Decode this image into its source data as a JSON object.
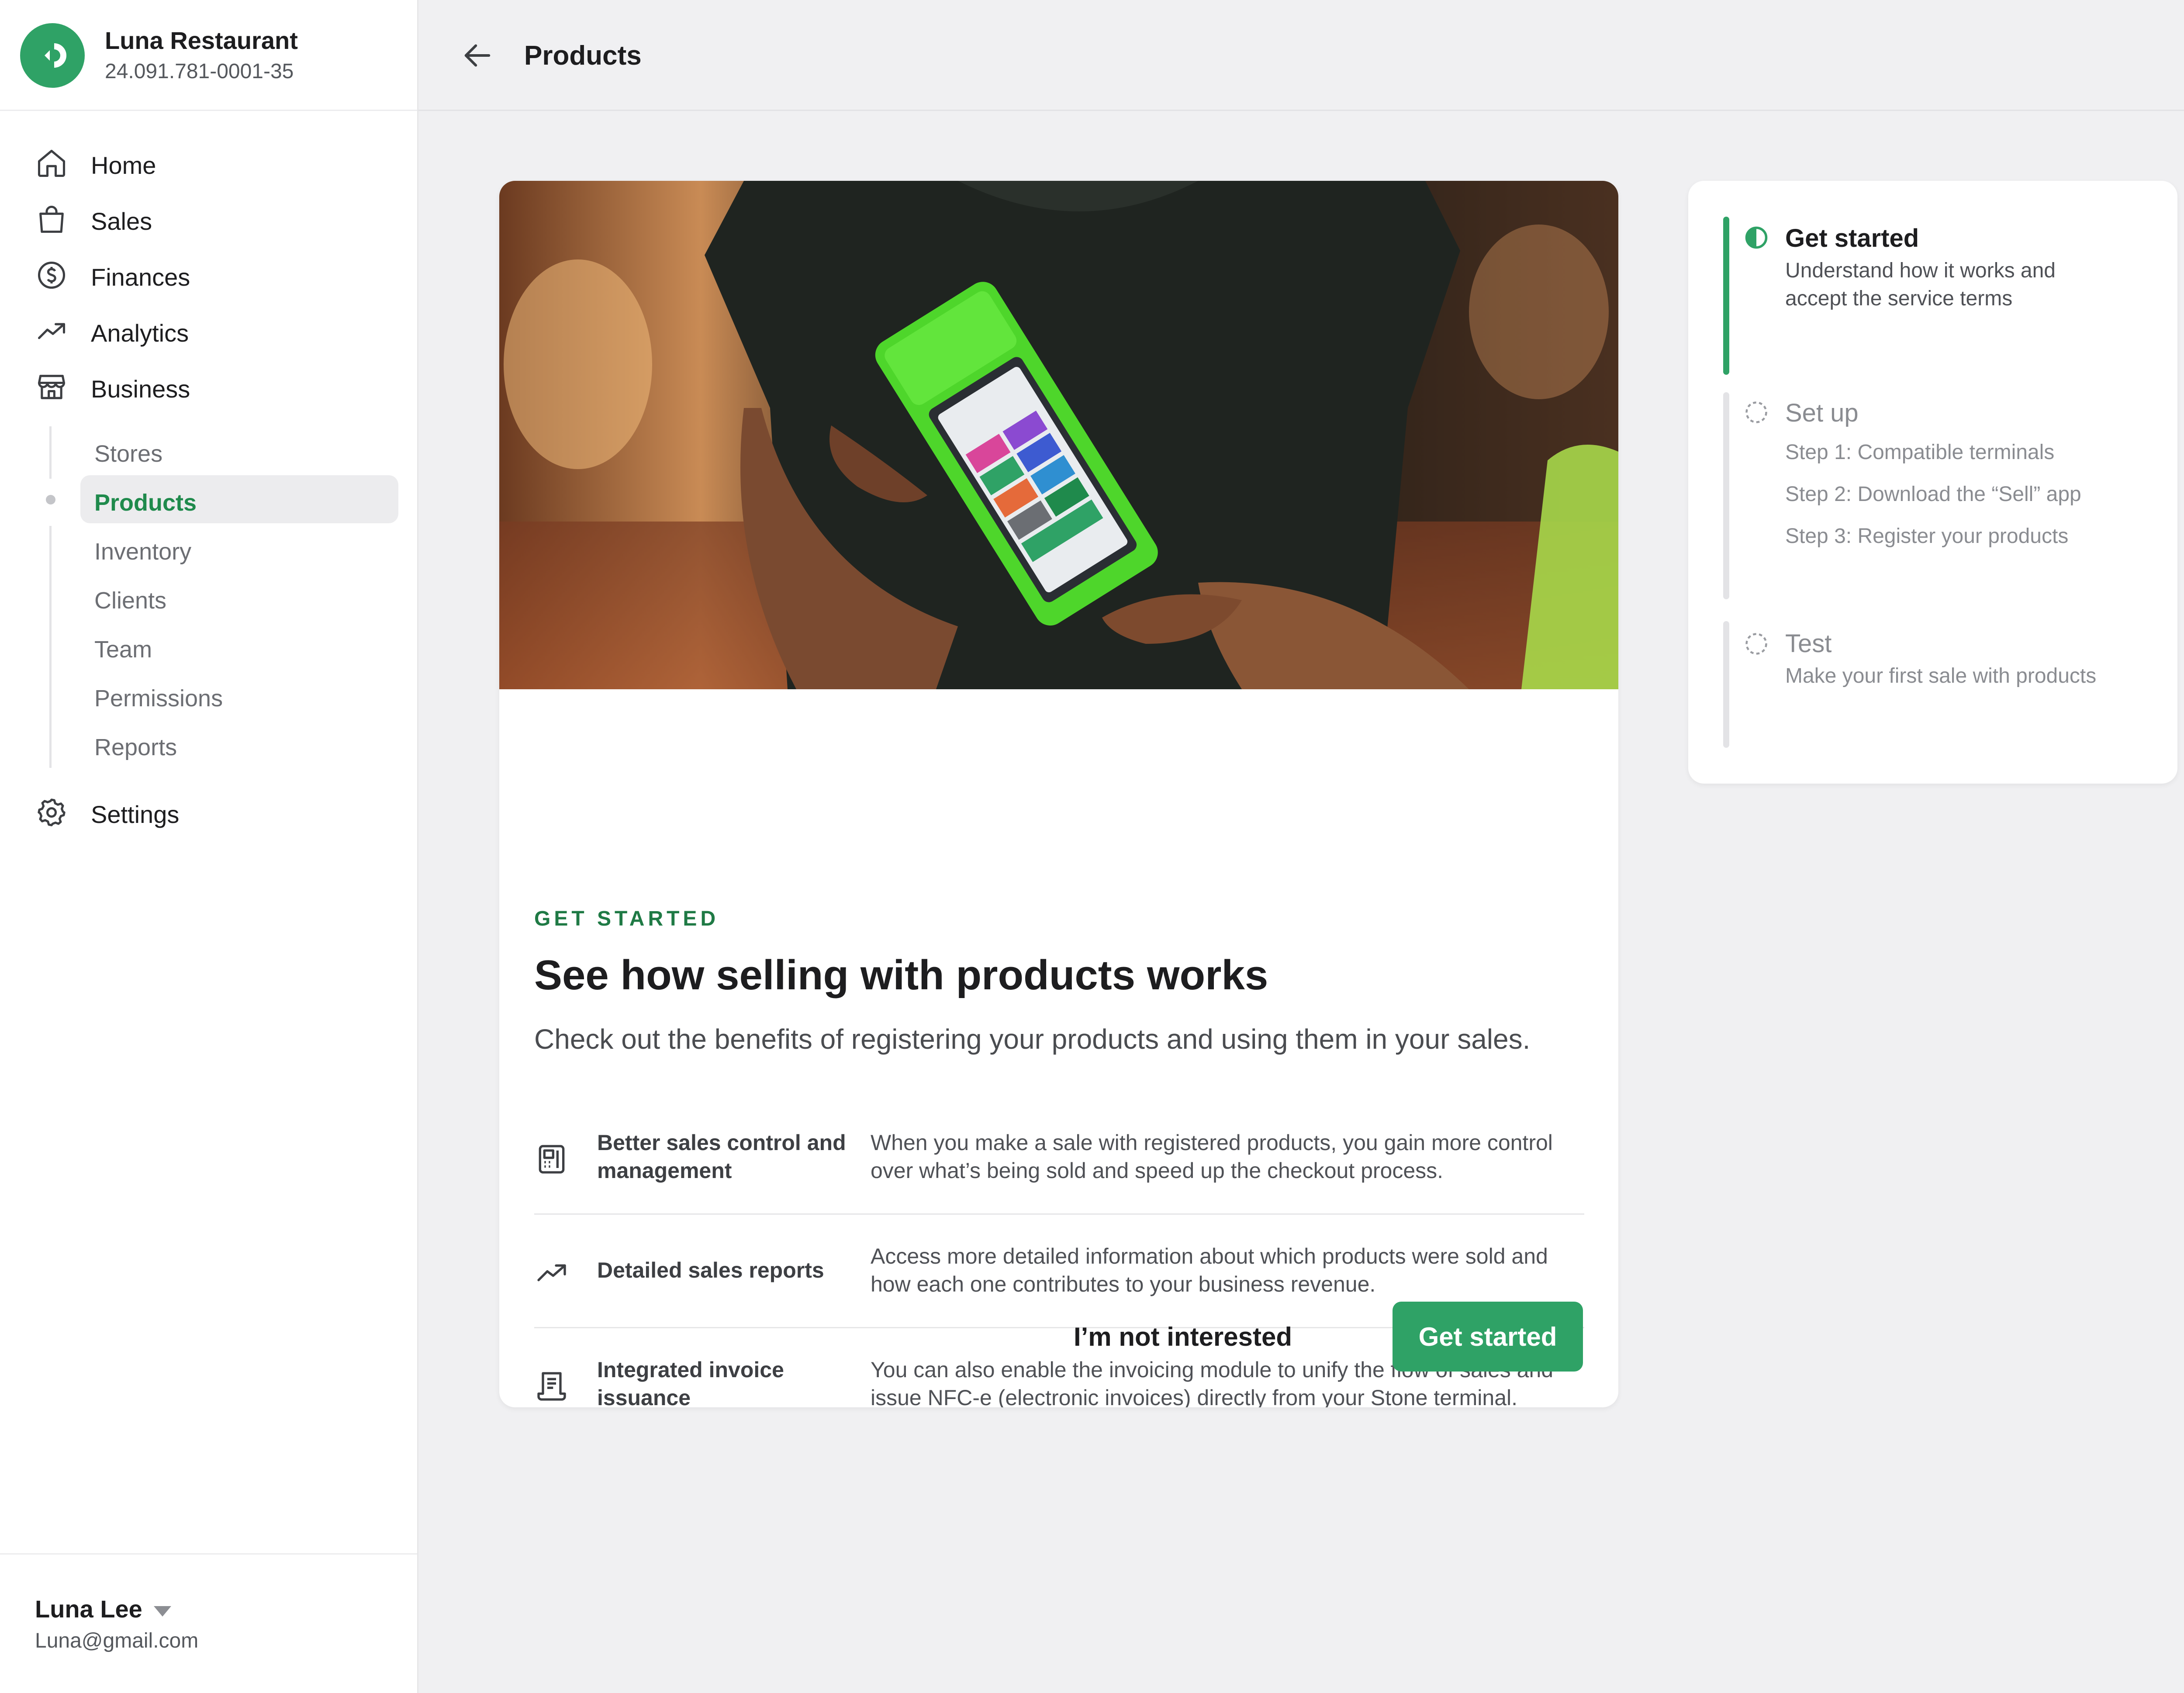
{
  "brand": {
    "name": "Luna Restaurant",
    "id": "24.091.781-0001-35",
    "color": "#2fa266"
  },
  "sidebar": {
    "items": [
      {
        "label": "Home",
        "icon": "home-icon"
      },
      {
        "label": "Sales",
        "icon": "shopping-bag-icon"
      },
      {
        "label": "Finances",
        "icon": "dollar-circle-icon"
      },
      {
        "label": "Analytics",
        "icon": "trend-up-icon"
      },
      {
        "label": "Business",
        "icon": "store-icon"
      }
    ],
    "sub_items": [
      {
        "label": "Stores"
      },
      {
        "label": "Products",
        "active": true
      },
      {
        "label": "Inventory"
      },
      {
        "label": "Clients"
      },
      {
        "label": "Team"
      },
      {
        "label": "Permissions"
      },
      {
        "label": "Reports"
      }
    ],
    "settings": {
      "label": "Settings",
      "icon": "gear-icon"
    }
  },
  "user": {
    "name": "Luna Lee",
    "email": "Luna@gmail.com"
  },
  "header": {
    "title": "Products"
  },
  "card": {
    "eyebrow": "GET STARTED",
    "title": "See how selling with products works",
    "subtitle": "Check out the benefits of registering your products and using them in your sales.",
    "benefits": [
      {
        "icon": "pos-terminal-icon",
        "title": "Better sales control and management",
        "description": "When you make a sale with registered products, you gain more control over what’s being sold and speed up the checkout process."
      },
      {
        "icon": "trend-up-icon",
        "title": "Detailed sales reports",
        "description": "Access more detailed information about which products were sold and how each one contributes to your business revenue."
      },
      {
        "icon": "receipt-icon",
        "title": "Integrated invoice issuance",
        "description": "You can also enable the invoicing module to unify the flow of sales and issue NFC-e (electronic invoices) directly from your Stone terminal."
      }
    ],
    "secondary_button": "I’m not interested",
    "primary_button": "Get started"
  },
  "steps": [
    {
      "title": "Get started",
      "lines": [
        "Understand how it works and",
        "accept the service terms"
      ],
      "state": "active"
    },
    {
      "title": "Set up",
      "lines": [
        "Step 1: Compatible terminals",
        "Step 2: Download the “Sell” app",
        "Step 3: Register your products"
      ],
      "state": "pending"
    },
    {
      "title": "Test",
      "lines": [
        "Make your first sale with products"
      ],
      "state": "pending"
    }
  ],
  "colors": {
    "accent": "#2fa266",
    "accent_text": "#1f8a4c",
    "background": "#f0f0f2"
  }
}
